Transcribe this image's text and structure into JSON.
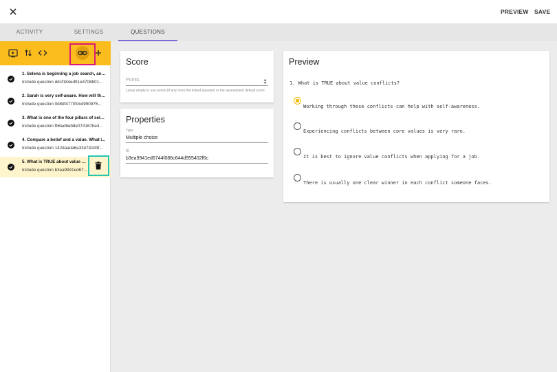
{
  "header": {
    "close_icon": "close-icon",
    "preview_label": "PREVIEW",
    "save_label": "SAVE"
  },
  "tabs": [
    {
      "label": "ACTIVITY",
      "active": false
    },
    {
      "label": "SETTINGS",
      "active": false
    },
    {
      "label": "QUESTIONS",
      "active": true
    }
  ],
  "toolbar": {
    "icons": [
      "play-icon",
      "reorder-icon",
      "code-icon",
      "link-icon",
      "add-icon"
    ],
    "accent_color": "#fbbd1e"
  },
  "questions": [
    {
      "title": "1. Selena is beginning a job search, and...",
      "subtitle": "Include question ddcf184ed91e4708b01..."
    },
    {
      "title": "2. Sarah is very self-aware. How will thi...",
      "subtitle": "Include question 0d8df4770fcb4990976..."
    },
    {
      "title": "3. What is one of the four pillars of self-...",
      "subtitle": "Include question fb6ad6eb8e074167be4..."
    },
    {
      "title": "4. Compare a belief and a value. What i...",
      "subtitle": "Include question 142daada6a33474183f..."
    },
    {
      "title": "5. What is TRUE about value con...",
      "subtitle": "Include question b3ea9941ed67...",
      "selected": true
    }
  ],
  "score": {
    "title": "Score",
    "points_placeholder": "Points",
    "help": "Leave empty to use points (if any) from the linked question or the assessment default score"
  },
  "properties": {
    "title": "Properties",
    "type_label": "Type",
    "type_value": "Multiple choice",
    "id_label": "ID",
    "id_value": "b3ea9941ed6744f086c644d955402f6c"
  },
  "preview": {
    "title": "Preview",
    "question": "1. What is TRUE about value conflicts?",
    "options": [
      {
        "text": "Working through these conflicts can help with self-awareness.",
        "selected": true
      },
      {
        "text": "Experiencing conflicts between core values is very rare.",
        "selected": false
      },
      {
        "text": "It is best to ignore value conflicts when applying for a job.",
        "selected": false
      },
      {
        "text": "There is usually one clear winner in each conflict someone faces.",
        "selected": false
      }
    ]
  }
}
